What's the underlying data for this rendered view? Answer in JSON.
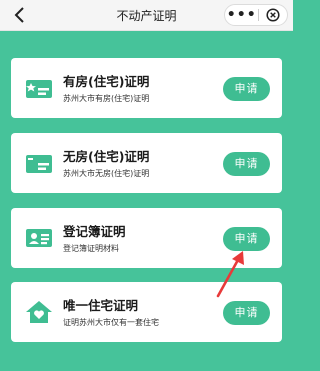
{
  "header": {
    "title": "不动产证明",
    "more_label": "•••"
  },
  "cards": [
    {
      "name": "有房(住宅)证明",
      "desc": "苏州大市有房(住宅)证明",
      "button": "申请",
      "icon": "house-certificate-icon"
    },
    {
      "name": "无房(住宅)证明",
      "desc": "苏州大市无房(住宅)证明",
      "button": "申请",
      "icon": "no-house-certificate-icon"
    },
    {
      "name": "登记簿证明",
      "desc": "登记簿证明材料",
      "button": "申请",
      "icon": "id-card-icon"
    },
    {
      "name": "唯一住宅证明",
      "desc": "证明苏州大市仅有一套住宅",
      "button": "申请",
      "icon": "home-heart-icon"
    }
  ],
  "colors": {
    "background": "#46c39a",
    "button": "#3fbd92",
    "icon": "#3fbd92",
    "annotation_arrow": "#e83a3a"
  }
}
